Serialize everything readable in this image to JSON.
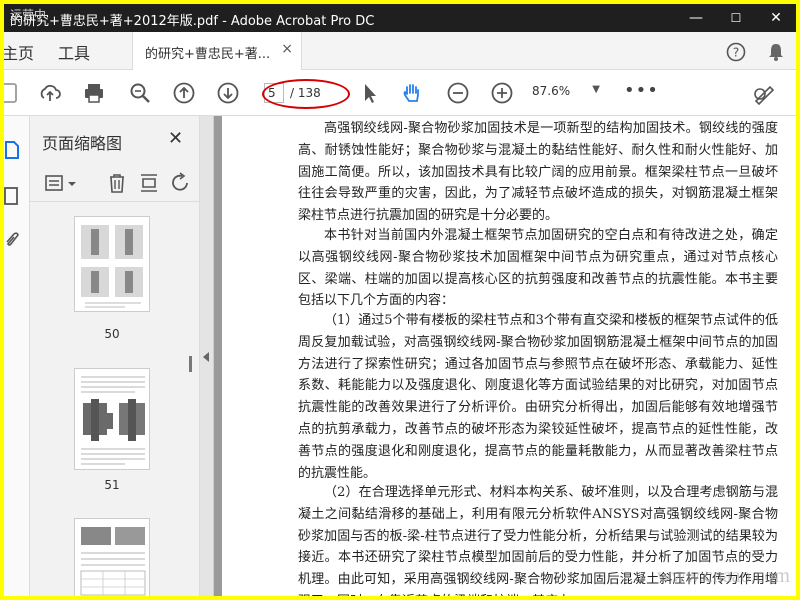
{
  "window": {
    "title": "的研究+曹忠民+著+2012年版.pdf - Adobe Acrobat Pro DC",
    "minimize": "—",
    "maximize": "☐",
    "close": "✕"
  },
  "menubar": {
    "home": "主页",
    "tools": "工具",
    "doc_tab": "的研究+曹忠民+著...",
    "doc_tab_close": "×"
  },
  "toolbar": {
    "current_page": "5",
    "page_total": "/ 138",
    "zoom": "87.6%",
    "zoom_caret": "▼",
    "more": "•••"
  },
  "thumbnails": {
    "title": "页面缩略图",
    "close": "✕",
    "pages": [
      {
        "number": "50"
      },
      {
        "number": "51"
      }
    ]
  },
  "document": {
    "paragraphs": [
      "高强钢绞线网-聚合物砂浆加固技术是一项新型的结构加固技术。钢绞线的强度高、耐锈蚀性能好；聚合物砂浆与混凝土的黏结性能好、耐久性和耐火性能好、加固施工简便。所以，该加固技术具有比较广阔的应用前景。框架梁柱节点一旦破坏往往会导致严重的灾害，因此，为了减轻节点破坏造成的损失，对钢筋混凝土框架梁柱节点进行抗震加固的研究是十分必要的。",
      "本书针对当前国内外混凝土框架节点加固研究的空白点和有待改进之处，确定以高强钢绞线网-聚合物砂浆技术加固框架中间节点为研究重点，通过对节点核心区、梁端、柱端的加固以提高核心区的抗剪强度和改善节点的抗震性能。本书主要包括以下几个方面的内容：",
      "（1）通过5个带有楼板的梁柱节点和3个带有直交梁和楼板的框架节点试件的低周反复加载试验，对高强钢绞线网-聚合物砂浆加固钢筋混凝土框架中间节点的加固方法进行了探索性研究；通过各加固节点与参照节点在破坏形态、承载能力、延性系数、耗能能力以及强度退化、刚度退化等方面试验结果的对比研究，对加固节点抗震性能的改善效果进行了分析评价。由研究分析得出，加固后能够有效地增强节点的抗剪承载力，改善节点的破坏形态为梁铰延性破坏，提高节点的延性性能，改善节点的强度退化和刚度退化，提高节点的能量耗散能力，从而显著改善梁柱节点的抗震性能。",
      "（2）在合理选择单元形式、材料本构关系、破坏准则，以及合理考虑钢筋与混凝土之间黏结滑移的基础上，利用有限元分析软件ANSYS对高强钢绞线网-聚合物砂浆加固与否的板-梁-柱节点进行了受力性能分析，分析结果与试验测试的结果较为接近。本书还研究了梁柱节点模型加固前后的受力性能，并分析了加固节点的受力机理。由此可知，采用高强钢绞线网-聚合物砂浆加固后混凝土斜压杆的传力作用增强了，同时，在靠近节点的梁端和柱端，其应力"
    ],
    "watermark": "www.cnaao.com"
  },
  "overlay": {
    "corner_mark": "运营中"
  },
  "colors": {
    "title_bar": "#1f1f1f",
    "highlight_border": "#ffff00",
    "annotation_ellipse": "#d60000",
    "active_tool": "#2680eb",
    "rail_active": "#1473e6"
  },
  "icons": [
    "save-icon",
    "upload-icon",
    "print-icon",
    "zoom-search-icon",
    "page-up-icon",
    "page-down-icon",
    "select-cursor-icon",
    "hand-tool-icon",
    "zoom-out-icon",
    "zoom-in-icon",
    "more-icon",
    "sign-icon",
    "help-icon",
    "bell-icon",
    "thumbnails-icon",
    "bookmark-icon",
    "attachment-icon",
    "options-icon",
    "delete-icon",
    "insert-page-icon",
    "rotate-icon"
  ]
}
